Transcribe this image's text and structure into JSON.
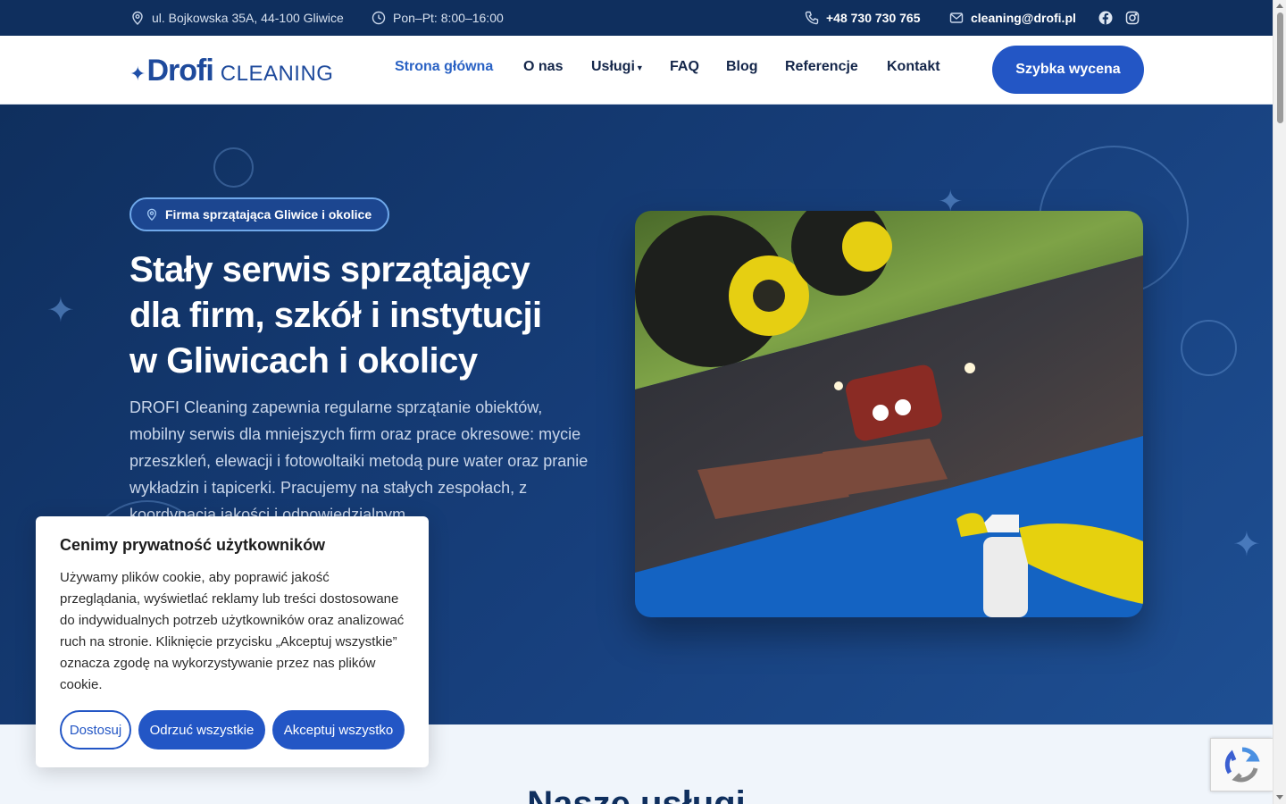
{
  "topbar": {
    "address": "ul. Bojkowska 35A, 44-100 Gliwice",
    "hours": "Pon–Pt: 8:00–16:00",
    "phone": "+48 730 730 765",
    "email": "cleaning@drofi.pl",
    "icons": [
      "map-pin-icon",
      "clock-icon",
      "phone-icon",
      "mail-icon",
      "facebook-icon",
      "instagram-icon"
    ]
  },
  "nav": {
    "logo_brand": "Drofi",
    "logo_sub": "CLEANING",
    "links": [
      "Strona główna",
      "O nas",
      "Usługi",
      "FAQ",
      "Blog",
      "Referencje",
      "Kontakt"
    ],
    "active": "Strona główna",
    "cta": "Szybka wycena"
  },
  "hero": {
    "badge": "Firma sprzątająca Gliwice i okolice",
    "title_line1": "Stały serwis sprzątający",
    "title_line2": "dla firm, szkół i instytucji",
    "title_line3": "w Gliwicach i okolicy",
    "description": "DROFI Cleaning zapewnia regularne sprzątanie obiektów, mobilny serwis dla mniejszych firm oraz prace okresowe: mycie przeszkleń, elewacji i fotowoltaiki metodą pure water oraz pranie wykładzin i tapicerki. Pracujemy na stałych zespołach, z koordynacją jakości i odpowiedzialnym"
  },
  "section": {
    "title": "Nasze usługi"
  },
  "cookie": {
    "title": "Cenimy prywatność użytkowników",
    "text": "Używamy plików cookie, aby poprawić jakość przeglądania, wyświetlać reklamy lub treści dostosowane do indywidualnych potrzeb użytkowników oraz analizować ruch na stronie. Kliknięcie przycisku „Akceptuj wszystkie” oznacza zgodę na wykorzystywanie przez nas plików cookie.",
    "customize": "Dostosuj",
    "reject": "Odrzuć wszystkie",
    "accept": "Akceptuj wszystko"
  },
  "colors": {
    "primary": "#2356c5",
    "navy": "#0f2f5e",
    "accent_yellow": "#e8d21e"
  }
}
